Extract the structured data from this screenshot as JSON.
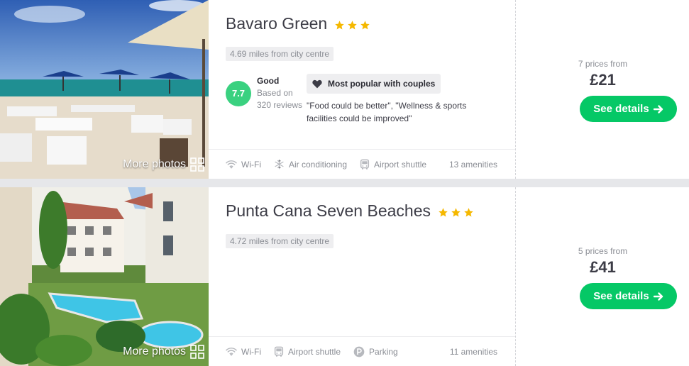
{
  "hotels": [
    {
      "name": "Bavaro Green",
      "stars": 3,
      "distance": "4.69 miles from city centre",
      "rating": {
        "score": "7.7",
        "word": "Good",
        "based_on": "Based on",
        "reviews": "320 reviews"
      },
      "badge": "Most popular with couples",
      "quote": "\"Food could be better\", \"Wellness & sports facilities could be improved\"",
      "amenities": [
        "Wi-Fi",
        "Air conditioning",
        "Airport shuttle"
      ],
      "amenity_icons": [
        "wifi-icon",
        "snowflake-icon",
        "bus-icon"
      ],
      "amenity_count": "13 amenities",
      "prices_from": "7 prices from",
      "price": "£21",
      "more_photos": "More photos",
      "cta": "See details"
    },
    {
      "name": "Punta Cana Seven Beaches",
      "stars": 3,
      "distance": "4.72 miles from city centre",
      "amenities": [
        "Wi-Fi",
        "Airport shuttle",
        "Parking"
      ],
      "amenity_icons": [
        "wifi-icon",
        "bus-icon",
        "parking-icon"
      ],
      "amenity_count": "11 amenities",
      "prices_from": "5 prices from",
      "price": "£41",
      "more_photos": "More photos",
      "cta": "See details"
    }
  ],
  "colors": {
    "accent_green": "#05c866",
    "score_green": "#3ad180",
    "star": "#f5b800"
  }
}
